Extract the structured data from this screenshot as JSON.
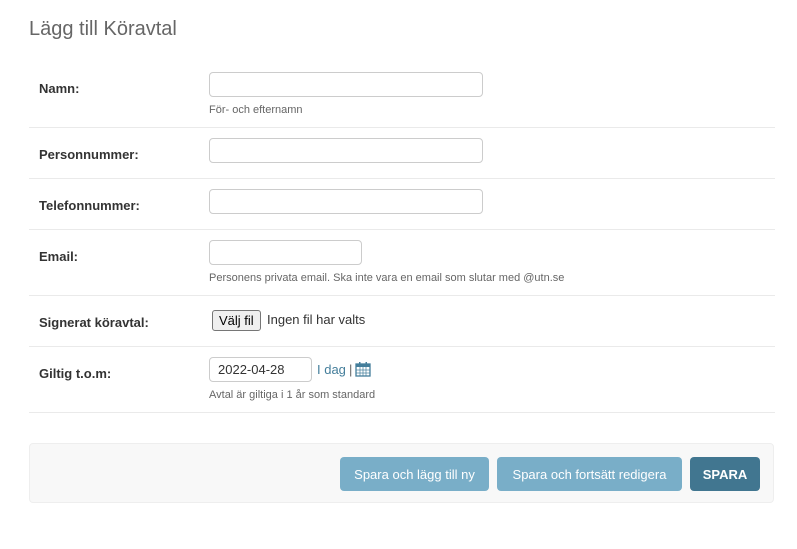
{
  "page": {
    "title": "Lägg till Köravtal"
  },
  "form": {
    "name": {
      "label": "Namn:",
      "value": "",
      "help": "För- och efternamn"
    },
    "personnummer": {
      "label": "Personnummer:",
      "value": ""
    },
    "telefon": {
      "label": "Telefonnummer:",
      "value": ""
    },
    "email": {
      "label": "Email:",
      "value": "",
      "help": "Personens privata email. Ska inte vara en email som slutar med @utn.se"
    },
    "signerat": {
      "label": "Signerat köravtal:",
      "button": "Välj fil",
      "status": "Ingen fil har valts"
    },
    "giltig": {
      "label": "Giltig t.o.m:",
      "value": "2022-04-28",
      "today": "I dag",
      "separator": "|",
      "help": "Avtal är giltiga i 1 år som standard"
    }
  },
  "actions": {
    "save_add": "Spara och lägg till ny",
    "save_continue": "Spara och fortsätt redigera",
    "save": "SPARA"
  },
  "colors": {
    "accent": "#417690",
    "accent_light": "#79aec8",
    "link": "#447e9b"
  },
  "icons": {
    "calendar": "calendar-icon"
  }
}
